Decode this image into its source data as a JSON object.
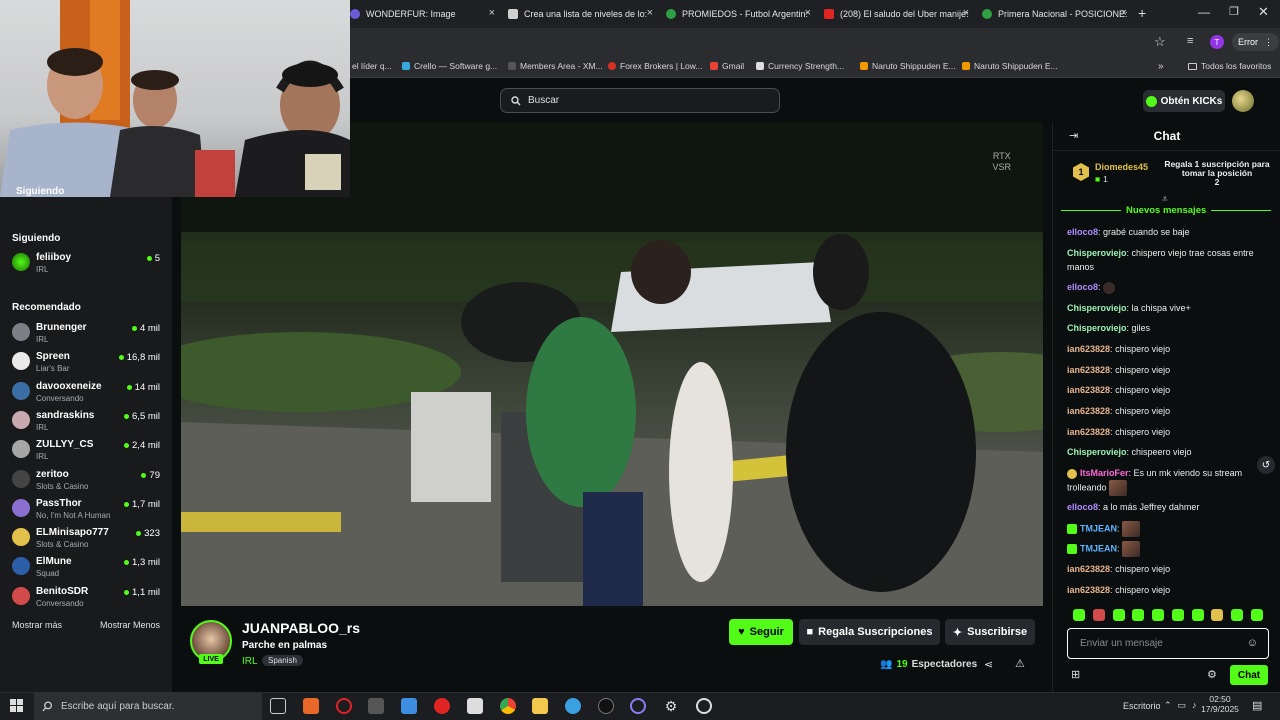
{
  "browser": {
    "tabs": [
      {
        "title": "WONDERFUR: Image",
        "color": "#6b5bd6"
      },
      {
        "title": "Crea una lista de niveles de lo:",
        "color": "#d0d0d0"
      },
      {
        "title": "PROMIEDOS - Futbol Argentin:",
        "color": "#2ea043"
      },
      {
        "title": "(208) El saludo del Uber manije:",
        "color": "#e02424"
      },
      {
        "title": "Primera Nacional - POSICIONE:",
        "color": "#2ea043"
      }
    ],
    "new_tab": "+",
    "profile_initial": "T",
    "error_label": "Error",
    "bookmarks": [
      "el líder q...",
      "Crello — Software g...",
      "Members Area - XM...",
      "Forex Brokers | Low...",
      "Gmail",
      "Currency Strength...",
      "Naruto Shippuden E...",
      "Naruto Shippuden E..."
    ],
    "bookmarks_all": "Todos los favoritos"
  },
  "kick": {
    "search_placeholder": "Buscar",
    "get_kicks": "Obtén KICKs"
  },
  "sidebar": {
    "following_header": "Siguiendo",
    "following_header_top": "Siguiendo",
    "following": [
      {
        "name": "feliiboy",
        "category": "IRL",
        "viewers": "5"
      }
    ],
    "recommended_header": "Recomendado",
    "recommended": [
      {
        "name": "Brunenger",
        "category": "IRL",
        "viewers": "4 mil",
        "color": "#7d7f86"
      },
      {
        "name": "Spreen",
        "category": "Liar's Bar",
        "viewers": "16,8 mil",
        "color": "#eaeaea"
      },
      {
        "name": "davooxeneize",
        "category": "Conversando",
        "viewers": "14 mil",
        "color": "#3a6ea5"
      },
      {
        "name": "sandraskins",
        "category": "IRL",
        "viewers": "6,5 mil",
        "color": "#c9a9b0"
      },
      {
        "name": "ZULLYY_CS",
        "category": "IRL",
        "viewers": "2,4 mil",
        "color": "#a6a6a6"
      },
      {
        "name": "zeritoo",
        "category": "Slots & Casino",
        "viewers": "79",
        "color": "#444"
      },
      {
        "name": "PassThor",
        "category": "No, I'm Not A Human",
        "viewers": "1,7 mil",
        "color": "#8a6fd1"
      },
      {
        "name": "ELMinisapo777",
        "category": "Slots & Casino",
        "viewers": "323",
        "color": "#e1c04b"
      },
      {
        "name": "ElMune",
        "category": "Squad",
        "viewers": "1,3 mil",
        "color": "#2d5ea8"
      },
      {
        "name": "BenitoSDR",
        "category": "Conversando",
        "viewers": "1,1 mil",
        "color": "#d14b4b"
      }
    ],
    "show_more": "Mostrar más",
    "show_less": "Mostrar Menos"
  },
  "video": {
    "overlay": [
      "RTX",
      "VSR"
    ]
  },
  "stream": {
    "channel": "JUANPABLOO_rs",
    "title": "Parche en palmas",
    "category": "IRL",
    "language": "Spanish",
    "live": "LIVE",
    "follow": "Seguir",
    "gift_subs": "Regala Suscripciones",
    "subscribe": "Suscribirse",
    "viewers": "19",
    "viewers_label": "Espectadores"
  },
  "chat": {
    "title": "Chat",
    "top_gifter": {
      "rank": "1",
      "name": "Diomedes45",
      "count": "1"
    },
    "gift_prompt": "Regala 1 suscripción para tomar la posición",
    "gift_position": "2",
    "new_messages": "Nuevos mensajes",
    "messages": [
      {
        "user": "elloco8",
        "color": "#b28cff",
        "text": "grabé cuando se baje"
      },
      {
        "user": "Chisperoviejo",
        "color": "#9cf2b6",
        "text": "chispero viejo trae cosas entre manos"
      },
      {
        "user": "elloco8",
        "color": "#b28cff",
        "text": ""
      },
      {
        "user": "Chisperoviejo",
        "color": "#9cf2b6",
        "text": "la chispa vive+"
      },
      {
        "user": "Chisperoviejo",
        "color": "#9cf2b6",
        "text": "giles"
      },
      {
        "user": "ian623828",
        "color": "#e7b58f",
        "text": "chispero viejo"
      },
      {
        "user": "ian623828",
        "color": "#e7b58f",
        "text": "chispero viejo"
      },
      {
        "user": "ian623828",
        "color": "#e7b58f",
        "text": "chispero viejo"
      },
      {
        "user": "ian623828",
        "color": "#e7b58f",
        "text": "chispero viejo"
      },
      {
        "user": "ian623828",
        "color": "#e7b58f",
        "text": "chispero viejo"
      },
      {
        "user": "Chisperoviejo",
        "color": "#9cf2b6",
        "text": "chispeero viejo"
      },
      {
        "user": "ItsMarioFer",
        "color": "#ff6ad5",
        "text": "Es un mk viendo su stream trolleando"
      },
      {
        "user": "elloco8",
        "color": "#b28cff",
        "text": "a lo más Jeffrey dahmer"
      },
      {
        "user": "TMJEAN",
        "color": "#5fb3ff",
        "text": ""
      },
      {
        "user": "TMJEAN",
        "color": "#5fb3ff",
        "text": ""
      },
      {
        "user": "ian623828",
        "color": "#e7b58f",
        "text": "chispero viejo"
      },
      {
        "user": "ian623828",
        "color": "#e7b58f",
        "text": "chispero viejo"
      }
    ],
    "input_placeholder": "Enviar un mensaje",
    "send_label": "Chat"
  },
  "taskbar": {
    "search_placeholder": "Escribe aquí para buscar.",
    "desktop_label": "Escritorio",
    "time": "02:50",
    "date": "17/9/2025"
  },
  "colors": {
    "accent": "#53fc18",
    "bg": "#0b0e0f",
    "panel": "#181a1c"
  }
}
